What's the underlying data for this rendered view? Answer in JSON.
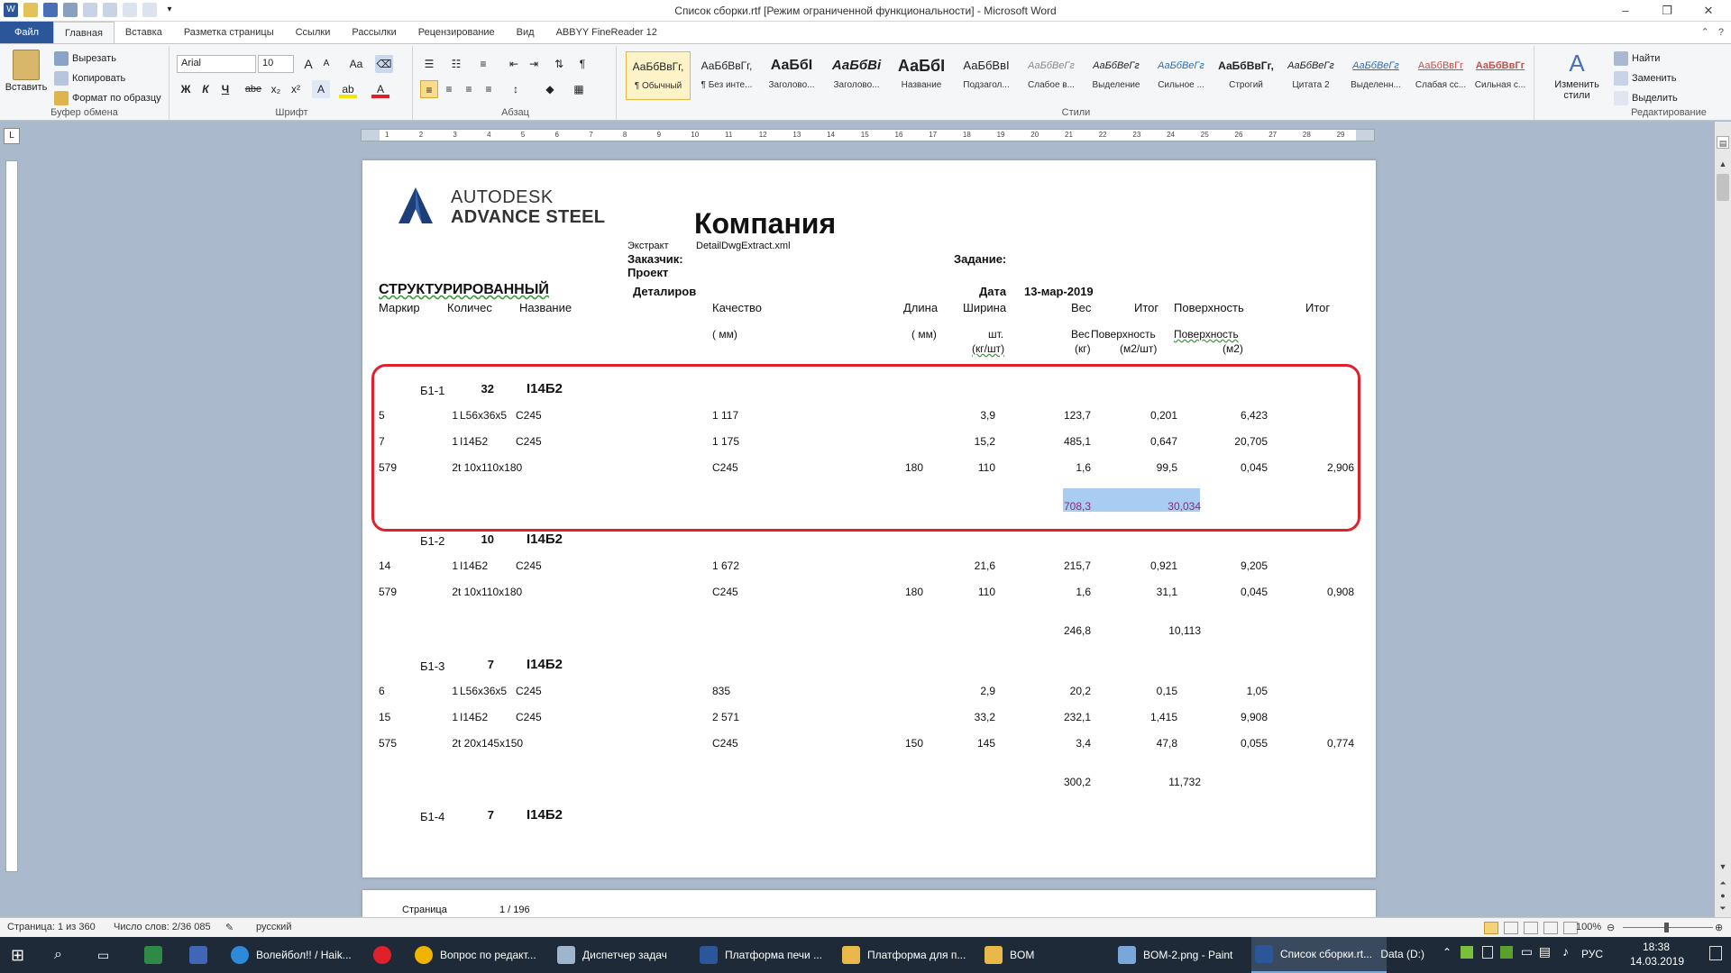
{
  "window": {
    "title": "Список сборки.rtf [Режим ограниченной функциональности] - Microsoft Word",
    "minimize": "–",
    "maximize": "❐",
    "close": "✕"
  },
  "tabs": [
    "Файл",
    "Главная",
    "Вставка",
    "Разметка страницы",
    "Ссылки",
    "Рассылки",
    "Рецензирование",
    "Вид",
    "ABBYY FineReader 12"
  ],
  "ribbon": {
    "clipboard": {
      "paste": "Вставить",
      "cut": "Вырезать",
      "copy": "Копировать",
      "format_painter": "Формат по образцу",
      "label": "Буфер обмена"
    },
    "font": {
      "name": "Arial",
      "size": "10",
      "label": "Шрифт",
      "bold": "Ж",
      "italic": "К",
      "underline": "Ч",
      "strike": "abe",
      "sub": "x₂",
      "sup": "x²",
      "grow": "A",
      "shrink": "A",
      "case": "Aa",
      "color_a": "A"
    },
    "paragraph": {
      "label": "Абзац",
      "pilcrow": "¶"
    },
    "styles": {
      "label": "Стили",
      "items": [
        {
          "sample": "АаБбВвГг,",
          "name": "¶ Обычный"
        },
        {
          "sample": "АаБбВвГг,",
          "name": "¶ Без инте..."
        },
        {
          "sample": "АаБбІ",
          "name": "Заголово..."
        },
        {
          "sample": "АаБбВі",
          "name": "Заголово..."
        },
        {
          "sample": "АаБбІ",
          "name": "Название"
        },
        {
          "sample": "АаБбВвІ",
          "name": "Подзагол..."
        },
        {
          "sample": "АаБбВеГг",
          "name": "Слабое в..."
        },
        {
          "sample": "АаБбВеГг",
          "name": "Выделение"
        },
        {
          "sample": "АаБбВеГг",
          "name": "Сильное ..."
        },
        {
          "sample": "АаБбВвГг,",
          "name": "Строгий"
        },
        {
          "sample": "АаБбВеГг",
          "name": "Цитата 2"
        },
        {
          "sample": "АаБбВеГг",
          "name": "Выделенн..."
        },
        {
          "sample": "АаБбВвГг",
          "name": "Слабая сс..."
        },
        {
          "sample": "АаБбВвГг",
          "name": "Сильная с..."
        }
      ],
      "change": "Изменить стили"
    },
    "editing": {
      "find": "Найти",
      "replace": "Заменить",
      "select": "Выделить",
      "label": "Редактирование"
    }
  },
  "ruler": {
    "ticks": [
      "1",
      "2",
      "3",
      "4",
      "5",
      "6",
      "7",
      "8",
      "9",
      "10",
      "11",
      "12",
      "13",
      "14",
      "15",
      "16",
      "17",
      "18",
      "19",
      "20",
      "21",
      "22",
      "23",
      "24",
      "25",
      "26",
      "27",
      "28",
      "29"
    ]
  },
  "document": {
    "logo_line1": "AUTODESK",
    "logo_line2": "ADVANCE STEEL",
    "company": "Компания",
    "extract_label": "Экстракт",
    "extract_value": "DetailDwgExtract.xml",
    "customer_label": "Заказчик:",
    "project_label": "Проект",
    "task_label": "Задание:",
    "structured": "СТРУКТУРИРОВАННЫЙ",
    "detailed": "Деталиров",
    "date_label": "Дата",
    "date_value": "13-мар-2019",
    "headers": {
      "mark": "Маркир",
      "qty": "Количес",
      "name": "Название",
      "quality": "Качество",
      "length": "Длина",
      "width": "Ширина",
      "weight": "Вес",
      "total": "Итог",
      "surface": "Поверхность",
      "total2": "Итог"
    },
    "subheaders": {
      "mm1": "( мм)",
      "mm2": "( мм)",
      "pcs": "шт.",
      "kg_pcs": "(кг/шт)",
      "weight2": "Вес",
      "kg": "(кг)",
      "surface2": "Поверхность",
      "m2_pcs": "(м2/шт)",
      "surface3": "Поверхность",
      "m2": "(м2)"
    },
    "assemblies": [
      {
        "mark": "Б1-1",
        "count": "32",
        "profile": "I14Б2",
        "rows": [
          [
            "5",
            "1",
            "L56x36x5",
            "C245",
            "1 117",
            "",
            "3,9",
            "123,7",
            "0,201",
            "6,423",
            ""
          ],
          [
            "7",
            "1",
            "I14Б2",
            "C245",
            "1 175",
            "",
            "15,2",
            "485,1",
            "0,647",
            "20,705",
            ""
          ],
          [
            "579",
            "2",
            "t 10x110x180",
            "",
            "C245",
            "180",
            "110",
            "1,6",
            "99,5",
            "0,045",
            "2,906"
          ]
        ],
        "sum_weight": "708,3",
        "sum_surface": "30,034"
      },
      {
        "mark": "Б1-2",
        "count": "10",
        "profile": "I14Б2",
        "rows": [
          [
            "14",
            "1",
            "I14Б2",
            "C245",
            "1 672",
            "",
            "21,6",
            "215,7",
            "0,921",
            "9,205",
            ""
          ],
          [
            "579",
            "2",
            "t 10x110x180",
            "",
            "C245",
            "180",
            "110",
            "1,6",
            "31,1",
            "0,045",
            "0,908"
          ]
        ],
        "sum_weight": "246,8",
        "sum_surface": "10,113"
      },
      {
        "mark": "Б1-3",
        "count": "7",
        "profile": "I14Б2",
        "rows": [
          [
            "6",
            "1",
            "L56x36x5",
            "C245",
            "835",
            "",
            "2,9",
            "20,2",
            "0,15",
            "1,05",
            ""
          ],
          [
            "15",
            "1",
            "I14Б2",
            "C245",
            "2 571",
            "",
            "33,2",
            "232,1",
            "1,415",
            "9,908",
            ""
          ],
          [
            "575",
            "2",
            "t 20x145x150",
            "",
            "C245",
            "150",
            "145",
            "3,4",
            "47,8",
            "0,055",
            "0,774"
          ]
        ],
        "sum_weight": "300,2",
        "sum_surface": "11,732"
      },
      {
        "mark": "Б1-4",
        "count": "7",
        "profile": "I14Б2",
        "rows": [],
        "sum_weight": "",
        "sum_surface": ""
      }
    ],
    "page2_label": "Страница",
    "page2_value": "1 / 196"
  },
  "statusbar": {
    "page": "Страница: 1 из 360",
    "words": "Число слов: 2/36 085",
    "lang": "русский",
    "zoom": "100%"
  },
  "taskbar": {
    "items": [
      "Волейбол!! / Haik...",
      "Вопрос по редакт...",
      "Диспетчер задач",
      "Платформа печи ...",
      "Платформа для п...",
      "BOM",
      "BOM-2.png - Paint",
      "Список сборки.rt..."
    ],
    "drive": "Data (D:)",
    "lang": "РУС",
    "time": "18:38",
    "date": "14.03.2019"
  },
  "colors": {
    "accent": "#2b579a",
    "highlight": "#e0202a",
    "selection": "#a9cdf2",
    "selected_text": "#8b2a7a"
  }
}
